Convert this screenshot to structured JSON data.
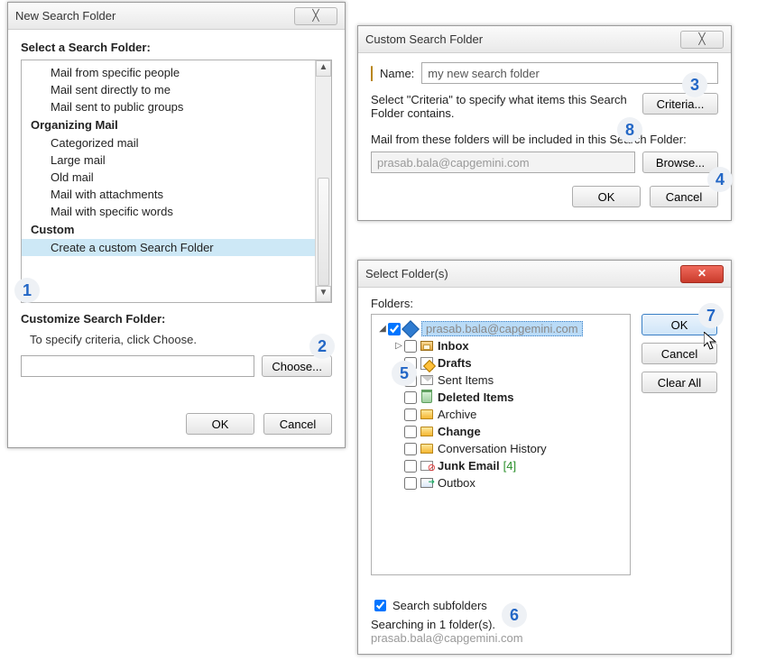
{
  "dialog_new": {
    "title": "New Search Folder",
    "heading": "Select a Search Folder:",
    "items": [
      {
        "type": "item",
        "label": "Mail from specific people"
      },
      {
        "type": "item",
        "label": "Mail sent directly to me"
      },
      {
        "type": "item",
        "label": "Mail sent to public groups"
      },
      {
        "type": "header",
        "label": "Organizing Mail"
      },
      {
        "type": "item",
        "label": "Categorized mail"
      },
      {
        "type": "item",
        "label": "Large mail"
      },
      {
        "type": "item",
        "label": "Old mail"
      },
      {
        "type": "item",
        "label": "Mail with attachments"
      },
      {
        "type": "item",
        "label": "Mail with specific words"
      },
      {
        "type": "header",
        "label": "Custom"
      },
      {
        "type": "item",
        "label": "Create a custom Search Folder",
        "selected": true
      }
    ],
    "customize_heading": "Customize Search Folder:",
    "customize_desc": "To specify criteria, click Choose.",
    "choose": "Choose...",
    "ok": "OK",
    "cancel": "Cancel"
  },
  "dialog_custom": {
    "title": "Custom Search Folder",
    "name_label": "Name:",
    "name_value": "my new search folder",
    "instr": "Select \"Criteria\" to specify what items this Search Folder contains.",
    "criteria": "Criteria...",
    "from_label": "Mail from these folders will be included in this Search Folder:",
    "path": "prasab.bala@capgemini.com",
    "browse": "Browse...",
    "ok": "OK",
    "cancel": "Cancel"
  },
  "dialog_select": {
    "title": "Select Folder(s)",
    "folders_label": "Folders:",
    "root": "prasab.bala@capgemini.com",
    "tree": {
      "inbox": "Inbox",
      "drafts": "Drafts",
      "sent": "Sent Items",
      "deleted": "Deleted Items",
      "archive": "Archive",
      "change": "Change",
      "convo": "Conversation History",
      "junk": "Junk Email",
      "junk_count": "[4]",
      "outbox": "Outbox"
    },
    "search_subfolders": "Search subfolders",
    "searching_in": "Searching in 1 folder(s).",
    "searching_path": "prasab.bala@capgemini.com",
    "ok": "OK",
    "cancel": "Cancel",
    "clear": "Clear All"
  },
  "callouts": {
    "1": "1",
    "2": "2",
    "3": "3",
    "4": "4",
    "5": "5",
    "6": "6",
    "7": "7",
    "8": "8"
  }
}
